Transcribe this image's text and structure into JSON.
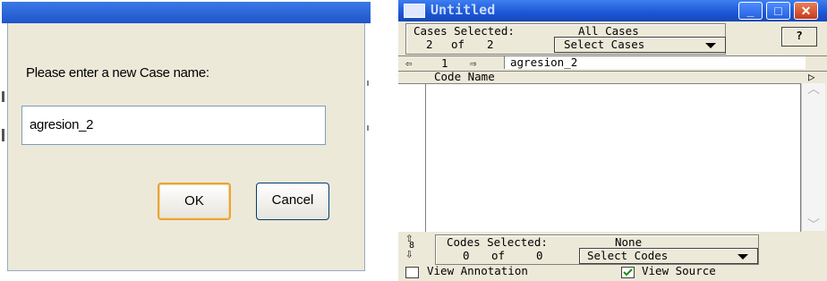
{
  "dialog": {
    "prompt": "Please enter a new Case name:",
    "input_value": "agresion_2",
    "ok_label": "OK",
    "cancel_label": "Cancel"
  },
  "window": {
    "title": "Untitled",
    "minimize_symbol": "_",
    "maximize_symbol": "□",
    "close_symbol": "✕",
    "help_label": "?",
    "cases": {
      "selected_label": "Cases Selected:",
      "selected_value": "All Cases",
      "current": "2",
      "of_label": "of",
      "total": "2",
      "select_label": "Select Cases"
    },
    "nav": {
      "back_arrow": "⇦",
      "index": "1",
      "forward_arrow": "⇨",
      "case_name": "agresion_2"
    },
    "code_list": {
      "header": "Code Name",
      "expand_arrow": "▷",
      "scroll_up": "︿",
      "scroll_down": "﹀"
    },
    "codes": {
      "up_arrow": "⇧",
      "middle_glyph": "8",
      "down_arrow": "⇩",
      "selected_label": "Codes Selected:",
      "selected_value": "None",
      "current": "0",
      "of_label": "of",
      "total": "0",
      "select_label": "Select Codes"
    },
    "options": {
      "view_annotation": "View Annotation",
      "view_annotation_checked": false,
      "view_source": "View Source",
      "view_source_checked": true
    }
  }
}
